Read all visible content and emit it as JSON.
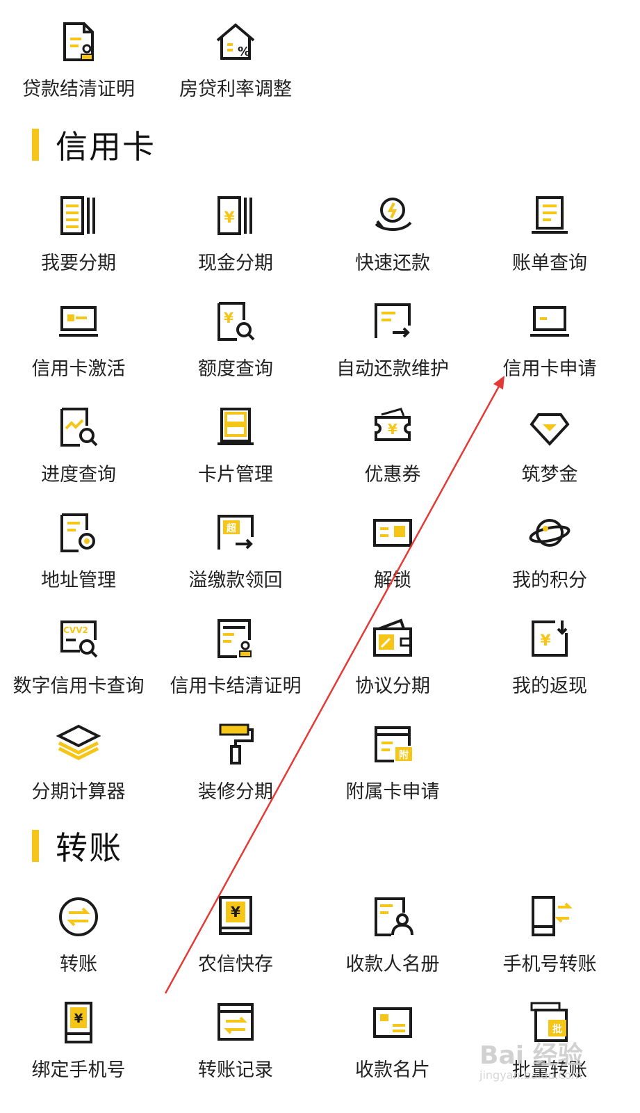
{
  "colors": {
    "accent": "#F5C518",
    "stroke": "#1a1a1a",
    "arrow": "#E53935"
  },
  "sections": [
    {
      "title": "信用卡"
    },
    {
      "title": "转账"
    }
  ],
  "items": [
    {
      "label": "贷款结清证明",
      "icon": "document-stamp-icon"
    },
    {
      "label": "房贷利率调整",
      "icon": "house-percent-icon"
    },
    {
      "label": "我要分期",
      "icon": "installment-document-icon"
    },
    {
      "label": "现金分期",
      "icon": "cash-installment-icon"
    },
    {
      "label": "快速还款",
      "icon": "fast-repay-icon"
    },
    {
      "label": "账单查询",
      "icon": "bill-document-icon"
    },
    {
      "label": "信用卡激活",
      "icon": "card-activate-icon"
    },
    {
      "label": "额度查询",
      "icon": "limit-search-icon"
    },
    {
      "label": "自动还款维护",
      "icon": "auto-repay-icon"
    },
    {
      "label": "信用卡申请",
      "icon": "card-apply-icon"
    },
    {
      "label": "进度查询",
      "icon": "progress-search-icon"
    },
    {
      "label": "卡片管理",
      "icon": "card-manage-icon"
    },
    {
      "label": "优惠券",
      "icon": "coupon-icon"
    },
    {
      "label": "筑梦金",
      "icon": "diamond-icon"
    },
    {
      "label": "地址管理",
      "icon": "address-settings-icon"
    },
    {
      "label": "溢缴款领回",
      "icon": "overpay-return-icon"
    },
    {
      "label": "解锁",
      "icon": "unlock-card-icon"
    },
    {
      "label": "我的积分",
      "icon": "planet-points-icon"
    },
    {
      "label": "数字信用卡查询",
      "icon": "cvv2-search-icon"
    },
    {
      "label": "信用卡结清证明",
      "icon": "card-settle-stamp-icon"
    },
    {
      "label": "协议分期",
      "icon": "agreement-wallet-icon"
    },
    {
      "label": "我的返现",
      "icon": "cashback-icon"
    },
    {
      "label": "分期计算器",
      "icon": "layers-icon"
    },
    {
      "label": "装修分期",
      "icon": "paint-roller-icon"
    },
    {
      "label": "附属卡申请",
      "icon": "supplementary-card-icon"
    },
    {
      "label": "转账",
      "icon": "transfer-arrows-icon"
    },
    {
      "label": "农信快存",
      "icon": "quick-deposit-icon"
    },
    {
      "label": "收款人名册",
      "icon": "payee-list-icon"
    },
    {
      "label": "手机号转账",
      "icon": "phone-transfer-icon"
    },
    {
      "label": "绑定手机号",
      "icon": "bind-phone-icon"
    },
    {
      "label": "转账记录",
      "icon": "transfer-record-icon"
    },
    {
      "label": "收款名片",
      "icon": "payee-card-icon"
    },
    {
      "label": "批量转账",
      "icon": "batch-transfer-icon"
    }
  ],
  "watermark": {
    "text": "Bai 经验",
    "sub": "jingyan.baidu.com"
  }
}
